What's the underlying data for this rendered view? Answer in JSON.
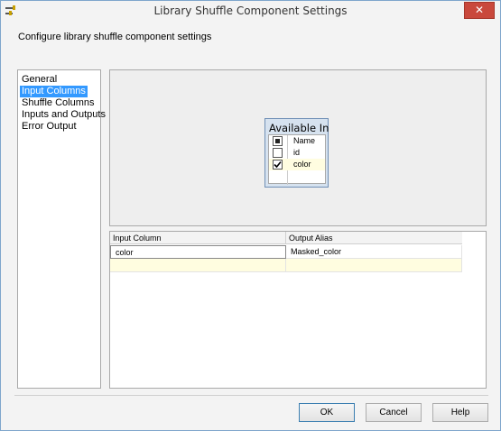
{
  "window": {
    "title": "Library Shuffle Component Settings",
    "close_glyph": "✕"
  },
  "subtitle": "Configure library shuffle component settings",
  "nav": {
    "items": [
      {
        "label": "General"
      },
      {
        "label": "Input Columns"
      },
      {
        "label": "Shuffle Columns"
      },
      {
        "label": "Inputs and Outputs"
      },
      {
        "label": "Error Output"
      }
    ],
    "selected": "Input Columns"
  },
  "available_inputs": {
    "title": "Available Inp...",
    "header": "Name",
    "columns": [
      {
        "label": "id",
        "checked": false
      },
      {
        "label": "color",
        "checked": true
      }
    ]
  },
  "grid": {
    "headers": [
      "Input Column",
      "Output Alias"
    ],
    "rows": [
      {
        "input_column": "color",
        "output_alias": "Masked_color"
      }
    ]
  },
  "buttons": {
    "ok": "OK",
    "cancel": "Cancel",
    "help": "Help"
  },
  "colors": {
    "selection": "#3399ff",
    "close_button": "#c9483c",
    "highlight_row": "#fffde0"
  }
}
